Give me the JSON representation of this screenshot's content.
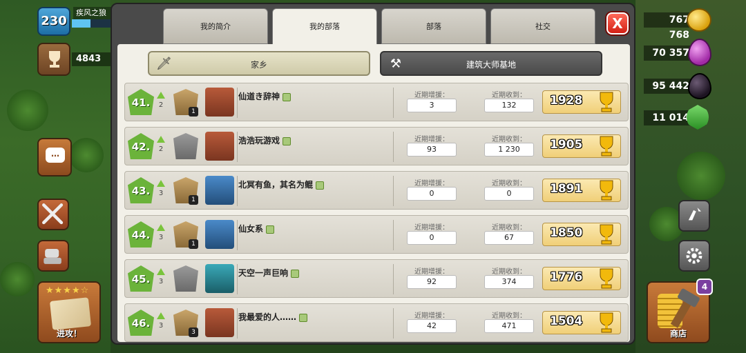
{
  "hud": {
    "level": "230",
    "player_name": "疾风之狼",
    "xp_fraction": 0.48,
    "trophies": "4843",
    "gold": "767 768",
    "elixir": "70 357",
    "dark_elixir": "95 442",
    "gems": "11 014",
    "attack_label": "进攻！",
    "shop_label": "商店",
    "shop_badge": "4",
    "chat_icon": "…",
    "close_label": "X",
    "star_rating": "★★★★☆"
  },
  "tabs": [
    {
      "label": "我的简介",
      "active": false
    },
    {
      "label": "我的部落",
      "active": true
    },
    {
      "label": "部落",
      "active": false
    },
    {
      "label": "社交",
      "active": false
    }
  ],
  "modes": {
    "home": "家乡",
    "builder": "建筑大师基地",
    "home_icon": "🗡",
    "builder_icon": "⚒"
  },
  "stat_labels": {
    "donated": "近期增援：",
    "received": "近期收到："
  },
  "members": [
    {
      "rank": "41.",
      "change": "2",
      "name": "仙道き辞神",
      "league": "badge",
      "league_tier": "1",
      "th_color": "red",
      "donated": "3",
      "received": "132",
      "trophies": "1928"
    },
    {
      "rank": "42.",
      "change": "2",
      "name": "浩浩玩游戏",
      "league": "shield",
      "league_tier": "",
      "th_color": "red",
      "donated": "93",
      "received": "1 230",
      "trophies": "1905"
    },
    {
      "rank": "43.",
      "change": "3",
      "name": "北冥有鱼，其名为鲲",
      "league": "badge",
      "league_tier": "1",
      "th_color": "blue",
      "donated": "0",
      "received": "0",
      "trophies": "1891"
    },
    {
      "rank": "44.",
      "change": "3",
      "name": "仙女系",
      "league": "badge",
      "league_tier": "1",
      "th_color": "blue",
      "donated": "0",
      "received": "67",
      "trophies": "1850"
    },
    {
      "rank": "45.",
      "change": "3",
      "name": "天空一声巨响",
      "league": "shield",
      "league_tier": "",
      "th_color": "teal",
      "donated": "92",
      "received": "374",
      "trophies": "1776"
    },
    {
      "rank": "46.",
      "change": "3",
      "name": "我最爱的人……",
      "league": "badge",
      "league_tier": "3",
      "th_color": "red",
      "donated": "42",
      "received": "471",
      "trophies": "1504"
    }
  ],
  "colors": {
    "rank_green": "#6bb33a",
    "trophy_gold": "#f0cf78",
    "close_red": "#d31f14"
  }
}
